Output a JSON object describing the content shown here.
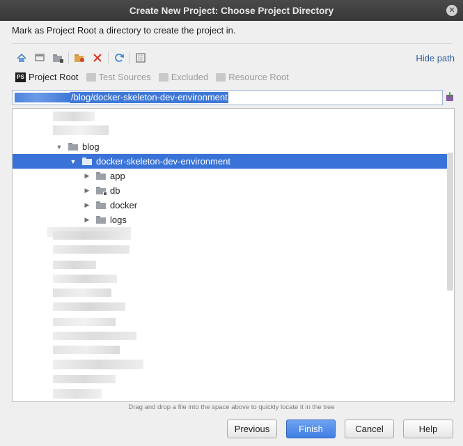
{
  "window": {
    "title": "Create New Project: Choose Project Directory",
    "close_glyph": "✕"
  },
  "description": "Mark as Project Root a directory to create the project in.",
  "toolbar": {
    "icons": [
      "home-icon",
      "desktop-icon",
      "project-folder-icon",
      "new-folder-icon",
      "delete-icon",
      "refresh-icon",
      "show-hidden-icon"
    ],
    "hide_path": "Hide path"
  },
  "marks": {
    "project_root": "Project Root",
    "test_sources": "Test Sources",
    "excluded": "Excluded",
    "resource_root": "Resource Root"
  },
  "path": {
    "value": "/blog/docker-skeleton-dev-environment"
  },
  "tree": {
    "rows": [
      {
        "label": "blog",
        "arrow": "▼"
      },
      {
        "label": "docker-skeleton-dev-environment",
        "arrow": "▼"
      },
      {
        "label": "app",
        "arrow": "▶"
      },
      {
        "label": "db",
        "arrow": "▶"
      },
      {
        "label": "docker",
        "arrow": "▶"
      },
      {
        "label": "logs",
        "arrow": "▶"
      }
    ]
  },
  "hint": "Drag and drop a file into the space above to quickly locate it in the tree",
  "buttons": {
    "previous": "Previous",
    "finish": "Finish",
    "cancel": "Cancel",
    "help": "Help"
  },
  "colors": {
    "selection": "#3a73d8",
    "accent": "#3f7fe3",
    "link": "#2f5d9a"
  }
}
